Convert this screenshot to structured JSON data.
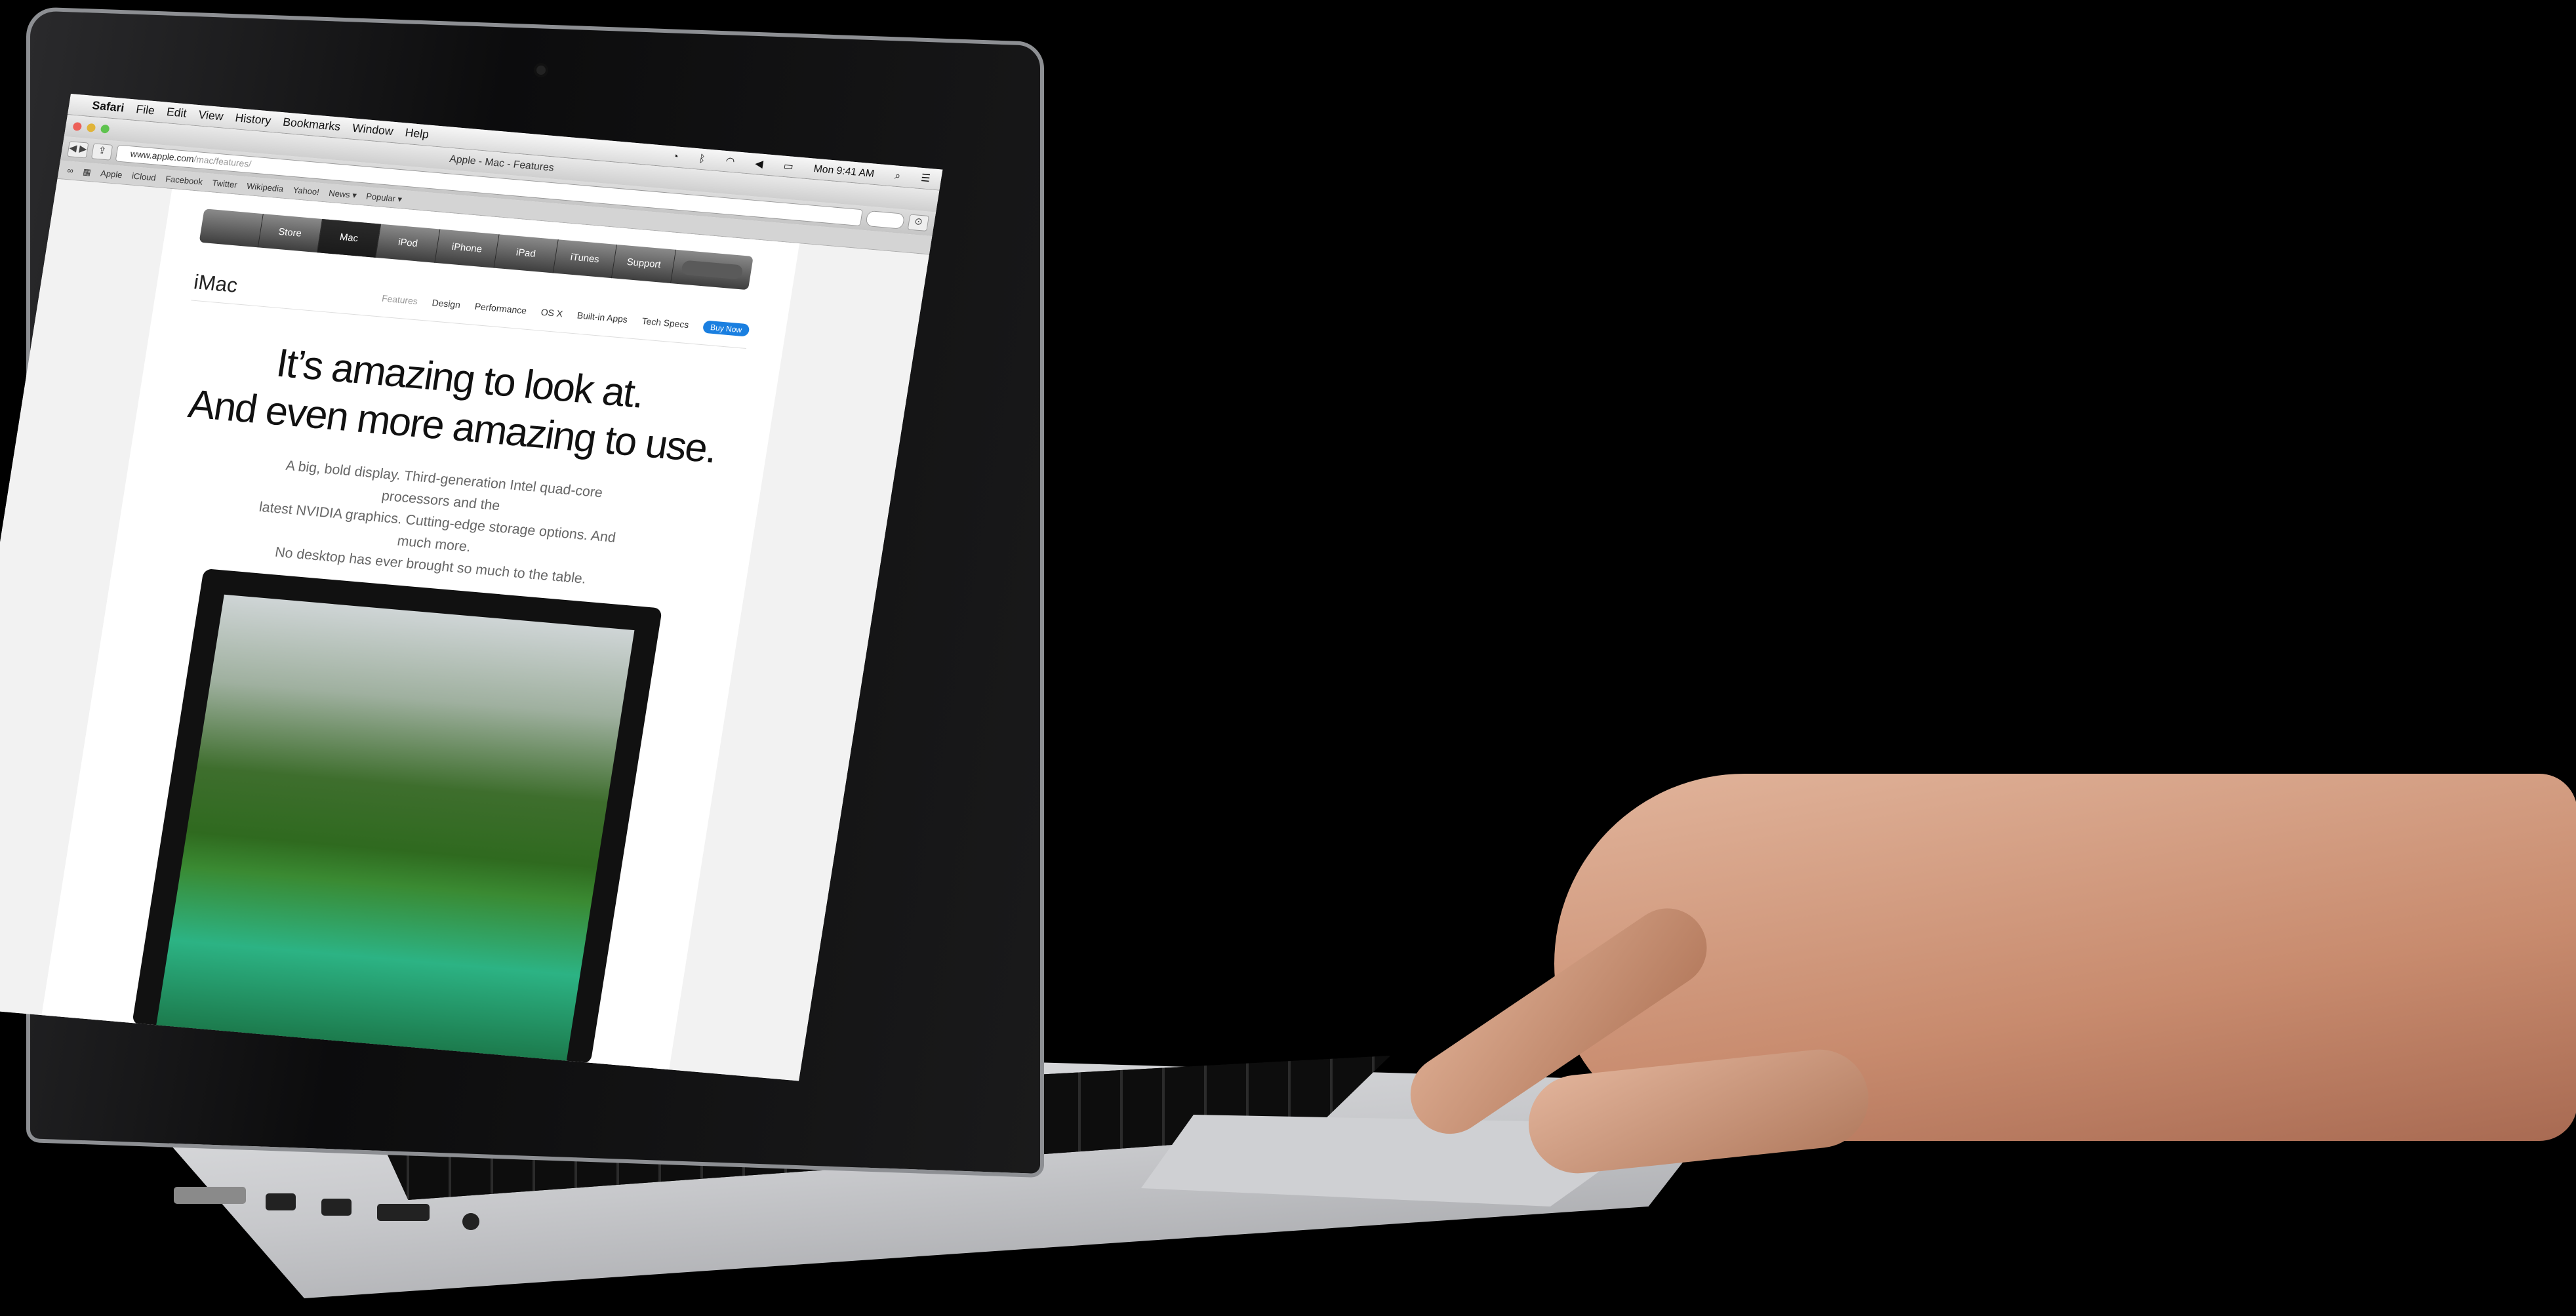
{
  "menubar": {
    "app": "Safari",
    "items": [
      "File",
      "Edit",
      "View",
      "History",
      "Bookmarks",
      "Window",
      "Help"
    ],
    "clock": "Mon 9:41 AM"
  },
  "window": {
    "title": "Apple - Mac - Features"
  },
  "toolbar": {
    "url_host": "www.apple.com",
    "url_path": "/mac/features/"
  },
  "bookmarks": [
    "Apple",
    "iCloud",
    "Facebook",
    "Twitter",
    "Wikipedia",
    "Yahoo!",
    "News ▾",
    "Popular ▾"
  ],
  "globalnav": [
    "Store",
    "Mac",
    "iPod",
    "iPhone",
    "iPad",
    "iTunes",
    "Support"
  ],
  "subnav": {
    "product": "iMac",
    "items": [
      "Features",
      "Design",
      "Performance",
      "OS X",
      "Built-in Apps",
      "Tech Specs"
    ],
    "buy": "Buy Now"
  },
  "hero": {
    "headline_line1": "It’s amazing to look at.",
    "headline_line2": "And even more amazing to use.",
    "lede_line1": "A big, bold display. Third-generation Intel quad-core processors and the",
    "lede_line2": "latest NVIDIA graphics. Cutting-edge storage options. And much more.",
    "lede_line3": "No desktop has ever brought so much to the table."
  },
  "colors": {
    "buy_button": "#1a7fe0",
    "background": "#000000"
  }
}
